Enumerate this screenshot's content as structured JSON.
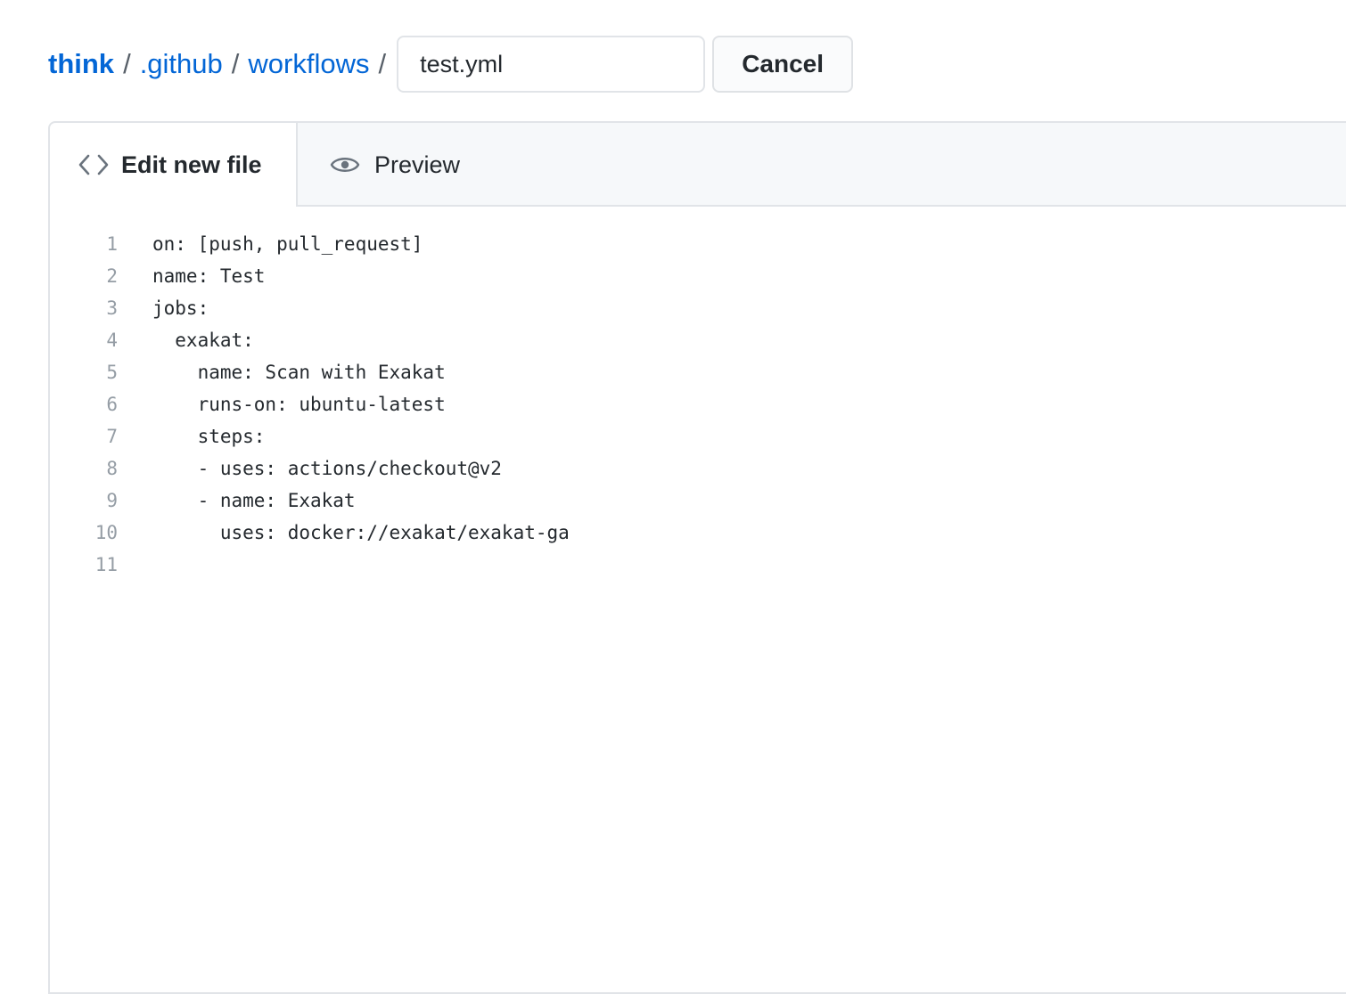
{
  "breadcrumb": {
    "repo": "think",
    "folder1": ".github",
    "folder2": "workflows",
    "separator": "/"
  },
  "filename_input": {
    "value": "test.yml"
  },
  "cancel_button": {
    "label": "Cancel"
  },
  "tabs": {
    "edit_label": "Edit new file",
    "edit_icon": "code-icon",
    "preview_label": "Preview",
    "preview_icon": "eye-icon"
  },
  "code_lines": [
    {
      "num": "1",
      "text": "on: [push, pull_request]"
    },
    {
      "num": "2",
      "text": "name: Test"
    },
    {
      "num": "3",
      "text": "jobs:"
    },
    {
      "num": "4",
      "text": "  exakat:"
    },
    {
      "num": "5",
      "text": "    name: Scan with Exakat"
    },
    {
      "num": "6",
      "text": "    runs-on: ubuntu-latest"
    },
    {
      "num": "7",
      "text": "    steps:"
    },
    {
      "num": "8",
      "text": "    - uses: actions/checkout@v2"
    },
    {
      "num": "9",
      "text": "    - name: Exakat"
    },
    {
      "num": "10",
      "text": "      uses: docker://exakat/exakat-ga"
    },
    {
      "num": "11",
      "text": ""
    }
  ],
  "colors": {
    "link": "#0366d6",
    "line_number": "#959da5",
    "text": "#24292e"
  }
}
